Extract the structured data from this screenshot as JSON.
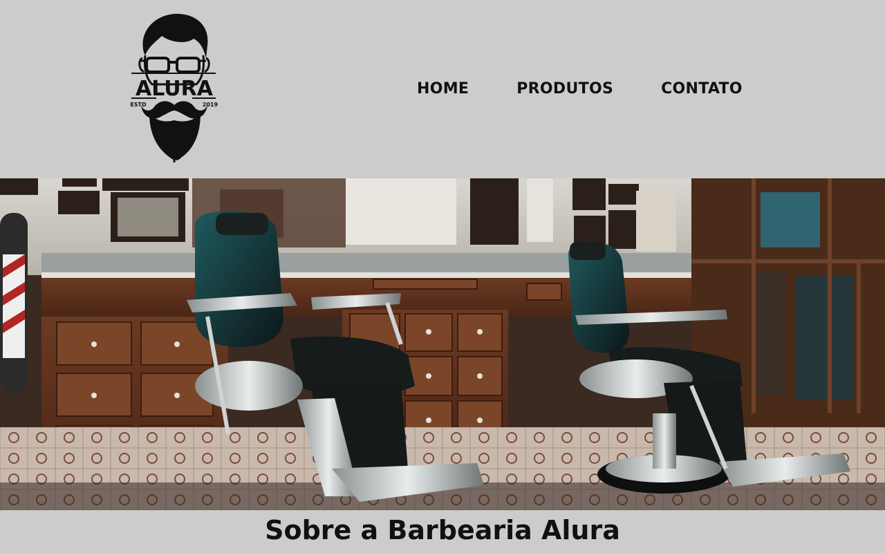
{
  "header": {
    "logo": {
      "brand": "ALURA",
      "estd_label": "ESTD",
      "year": "2019",
      "icon": "bearded-man-with-glasses-logo"
    },
    "nav": [
      {
        "label": "HOME"
      },
      {
        "label": "PRODUTOS"
      },
      {
        "label": "CONTATO"
      }
    ]
  },
  "hero": {
    "image": "barbershop-interior-photo"
  },
  "about": {
    "title": "Sobre a Barbearia Alura"
  },
  "colors": {
    "header_bg": "#cccccc",
    "text": "#111111"
  }
}
